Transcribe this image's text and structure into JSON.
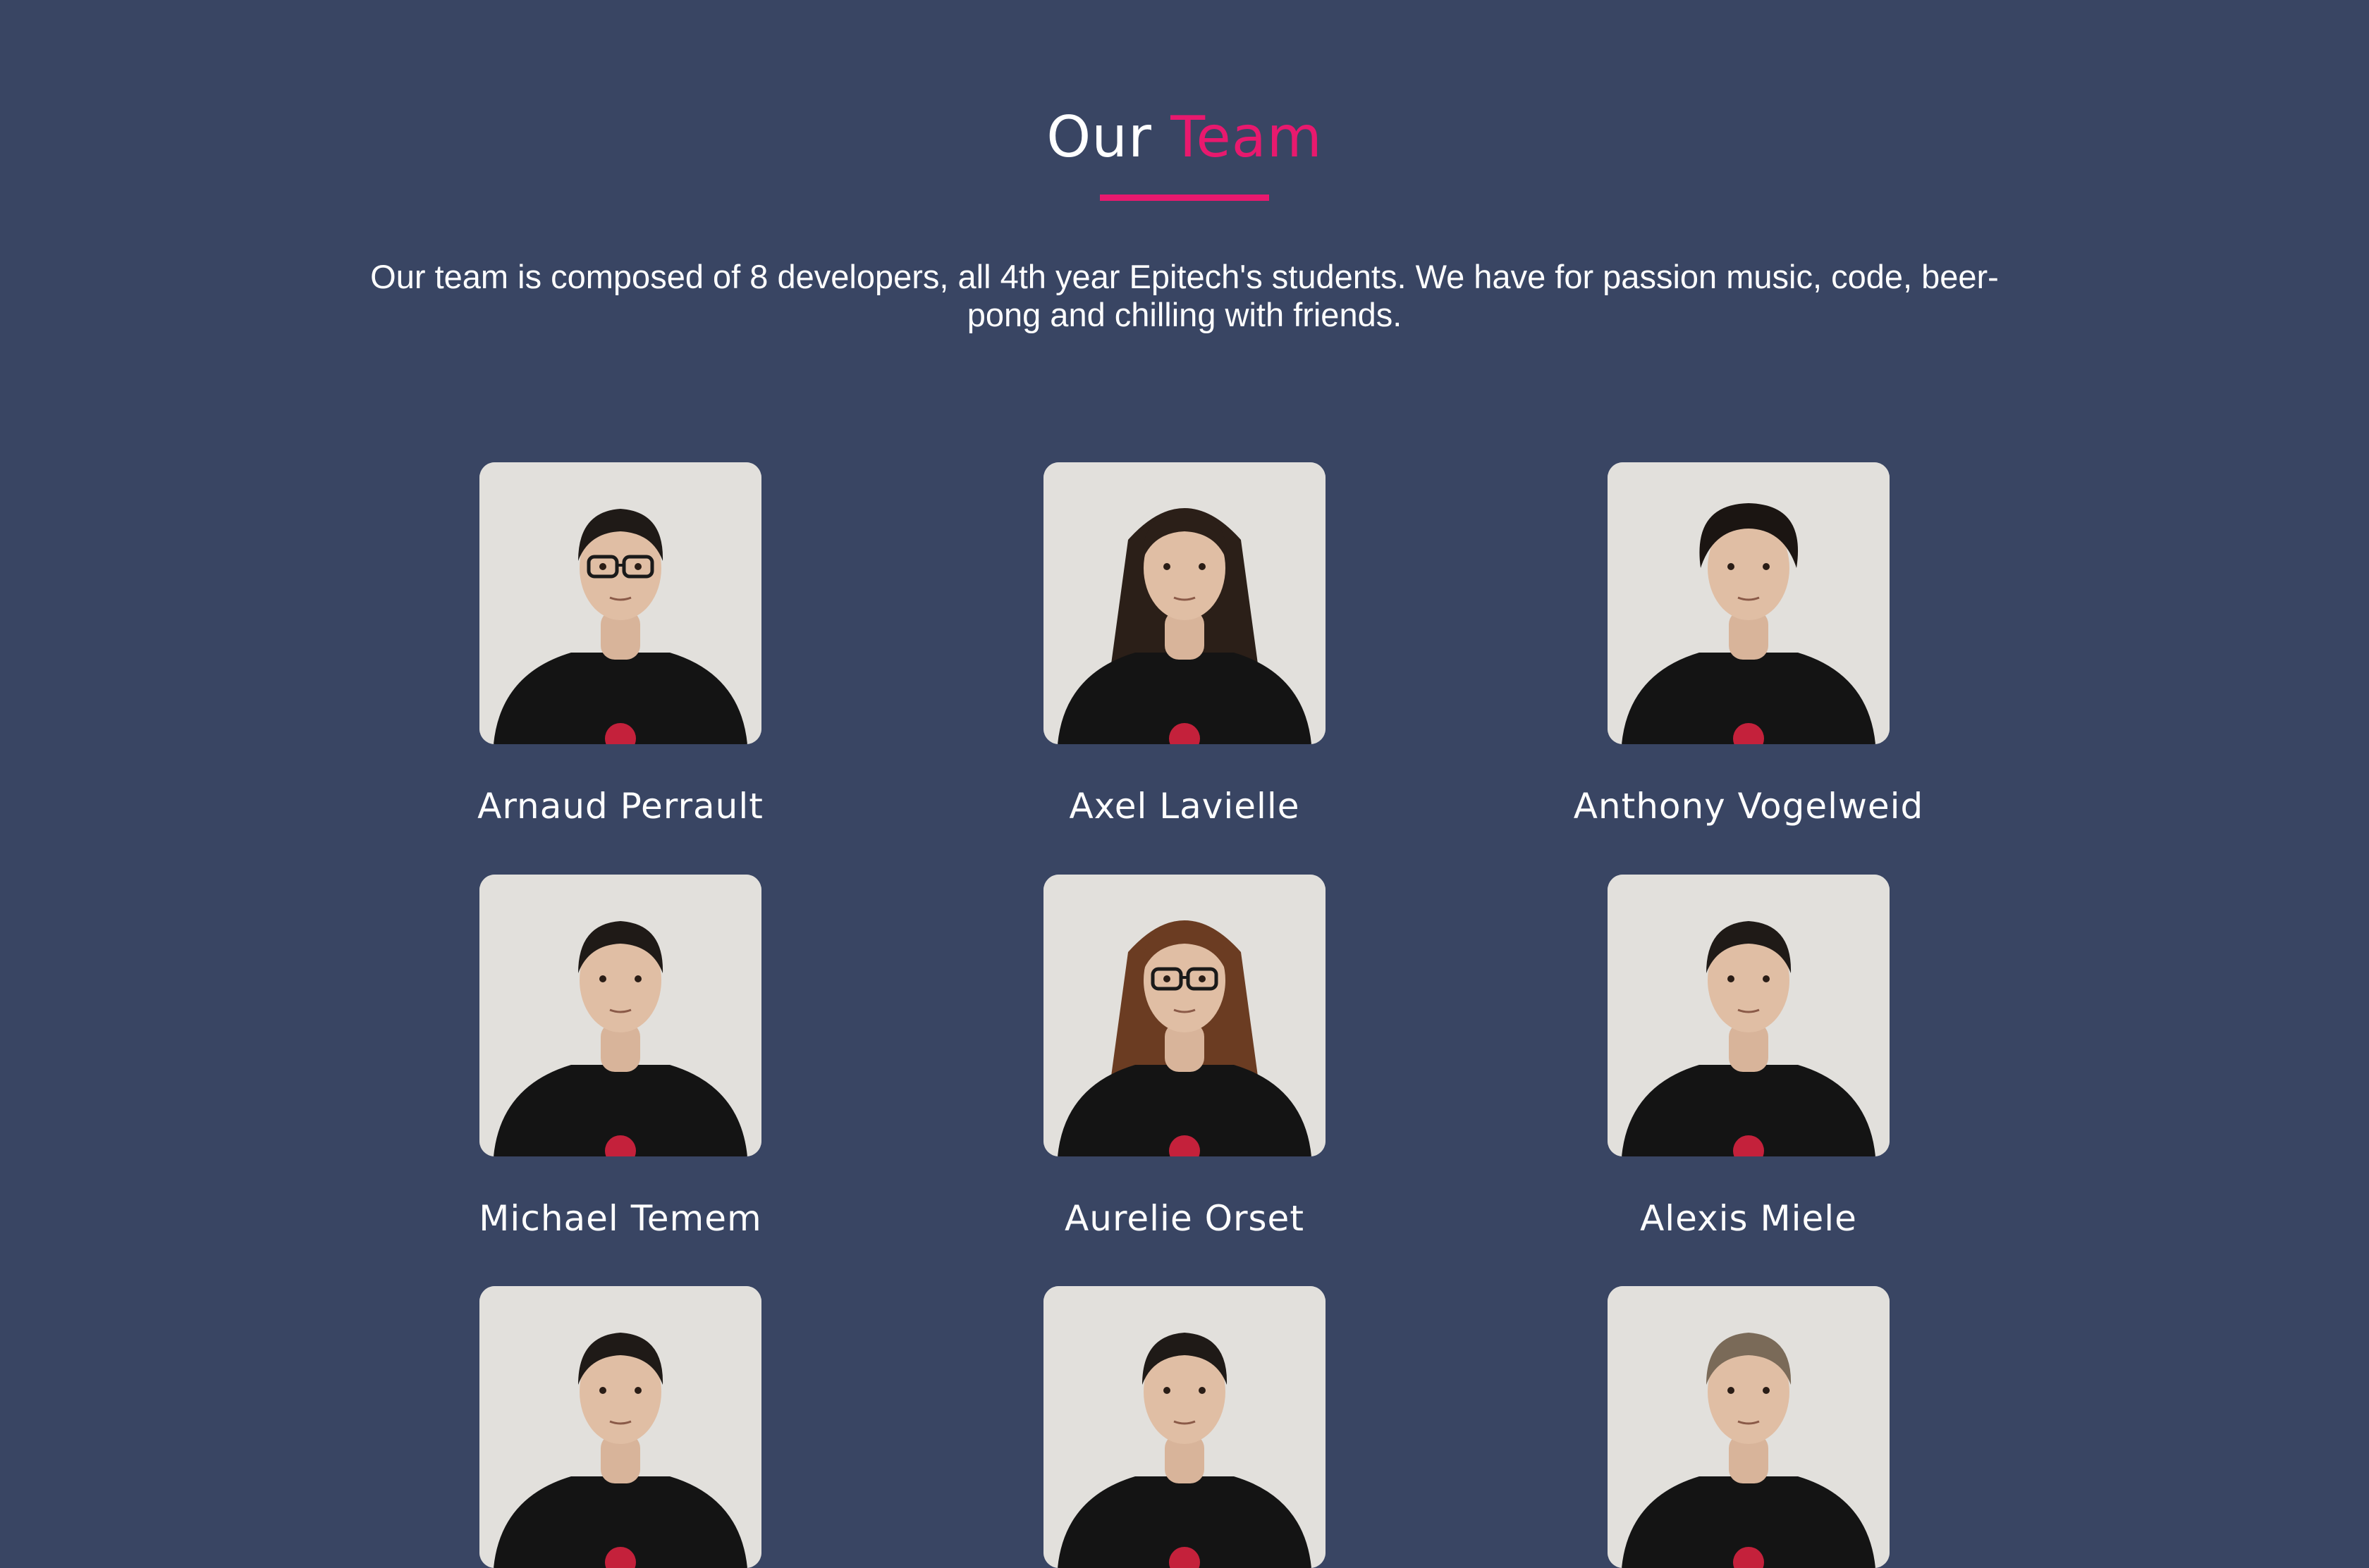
{
  "header": {
    "title_part1": "Our",
    "title_part2": "Team",
    "accent_color": "#e8196e"
  },
  "intro": {
    "text": "Our team is composed of 8 developers, all 4th year Epitech's students. We have for passion music, code, beer-pong and chilling with friends."
  },
  "background_color": "#394563",
  "members": [
    {
      "name": "Arnaud Perrault",
      "hair": "short-dark",
      "glasses": true
    },
    {
      "name": "Axel Lavielle",
      "hair": "long-dark",
      "glasses": false
    },
    {
      "name": "Anthony Vogelweid",
      "hair": "curly-dark",
      "glasses": false
    },
    {
      "name": "Michael Temem",
      "hair": "short-dark",
      "glasses": false
    },
    {
      "name": "Aurelie Orset",
      "hair": "long-auburn",
      "glasses": true
    },
    {
      "name": "Alexis Miele",
      "hair": "short-dark",
      "glasses": false
    },
    {
      "name": "",
      "hair": "short-dark",
      "glasses": false
    },
    {
      "name": "",
      "hair": "short-dark",
      "glasses": false
    },
    {
      "name": "",
      "hair": "short-light",
      "glasses": false
    }
  ]
}
